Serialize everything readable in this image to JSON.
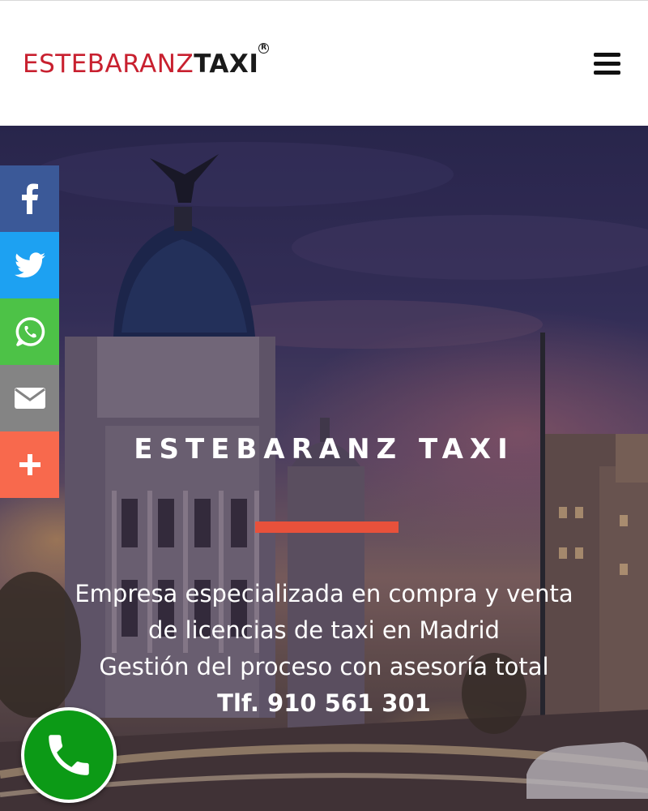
{
  "header": {
    "logo_light": "ESTEBARANZ",
    "logo_bold": "TAXI",
    "logo_mark": "R",
    "menu_icon": "hamburger-menu-icon"
  },
  "share": {
    "items": [
      {
        "name": "facebook",
        "icon": "facebook-icon",
        "color": "#3b5998"
      },
      {
        "name": "twitter",
        "icon": "twitter-icon",
        "color": "#1da1f2"
      },
      {
        "name": "whatsapp",
        "icon": "whatsapp-icon",
        "color": "#4dc247"
      },
      {
        "name": "email",
        "icon": "email-icon",
        "color": "#848484"
      },
      {
        "name": "more",
        "icon": "plus-icon",
        "color": "#f8694d"
      }
    ]
  },
  "hero": {
    "title": "ESTEBARANZ TAXI",
    "line1": "Empresa especializada en compra y venta",
    "line2": "de licencias de taxi en Madrid",
    "line3": "Gestión del proceso con asesoría total",
    "phone": "Tlf. 910 561 301",
    "accent_color": "#e8513b"
  },
  "call_button": {
    "icon": "phone-icon",
    "color": "#0c9a16"
  }
}
